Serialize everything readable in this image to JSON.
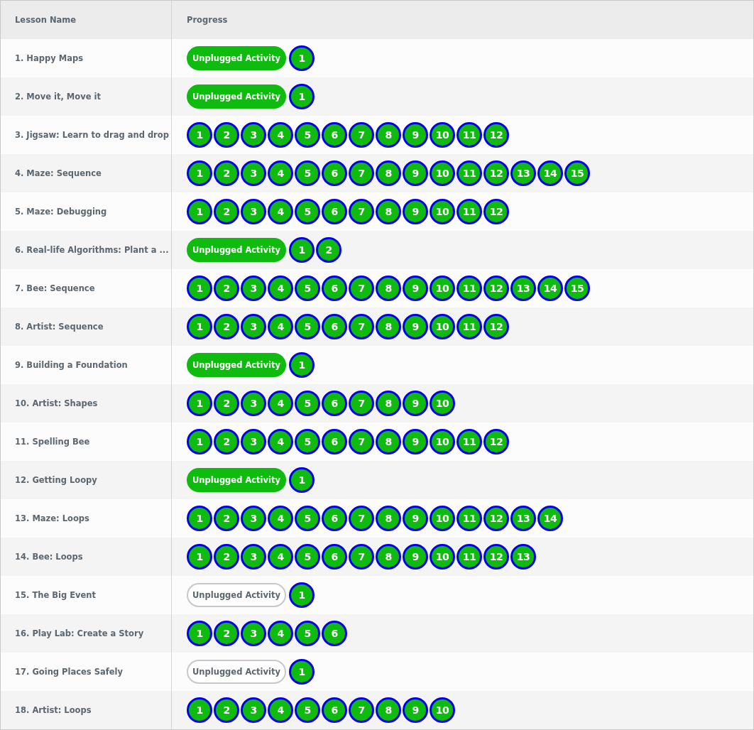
{
  "table": {
    "columns": [
      "Lesson Name",
      "Progress"
    ],
    "rows": [
      {
        "name": "1. Happy Maps",
        "unplugged": {
          "label": "Unplugged Activity",
          "completed": true
        },
        "levels": [
          "1"
        ]
      },
      {
        "name": "2. Move it, Move it",
        "unplugged": {
          "label": "Unplugged Activity",
          "completed": true
        },
        "levels": [
          "1"
        ]
      },
      {
        "name": "3. Jigsaw: Learn to drag and drop",
        "levels": [
          "1",
          "2",
          "3",
          "4",
          "5",
          "6",
          "7",
          "8",
          "9",
          "10",
          "11",
          "12"
        ]
      },
      {
        "name": "4. Maze: Sequence",
        "levels": [
          "1",
          "2",
          "3",
          "4",
          "5",
          "6",
          "7",
          "8",
          "9",
          "10",
          "11",
          "12",
          "13",
          "14",
          "15"
        ]
      },
      {
        "name": "5. Maze: Debugging",
        "levels": [
          "1",
          "2",
          "3",
          "4",
          "5",
          "6",
          "7",
          "8",
          "9",
          "10",
          "11",
          "12"
        ]
      },
      {
        "name": "6. Real-life Algorithms: Plant a ...",
        "unplugged": {
          "label": "Unplugged Activity",
          "completed": true
        },
        "levels": [
          "1",
          "2"
        ]
      },
      {
        "name": "7. Bee: Sequence",
        "levels": [
          "1",
          "2",
          "3",
          "4",
          "5",
          "6",
          "7",
          "8",
          "9",
          "10",
          "11",
          "12",
          "13",
          "14",
          "15"
        ]
      },
      {
        "name": "8. Artist: Sequence",
        "levels": [
          "1",
          "2",
          "3",
          "4",
          "5",
          "6",
          "7",
          "8",
          "9",
          "10",
          "11",
          "12"
        ]
      },
      {
        "name": "9. Building a Foundation",
        "unplugged": {
          "label": "Unplugged Activity",
          "completed": true
        },
        "levels": [
          "1"
        ]
      },
      {
        "name": "10. Artist: Shapes",
        "levels": [
          "1",
          "2",
          "3",
          "4",
          "5",
          "6",
          "7",
          "8",
          "9",
          "10"
        ]
      },
      {
        "name": "11. Spelling Bee",
        "levels": [
          "1",
          "2",
          "3",
          "4",
          "5",
          "6",
          "7",
          "8",
          "9",
          "10",
          "11",
          "12"
        ]
      },
      {
        "name": "12. Getting Loopy",
        "unplugged": {
          "label": "Unplugged Activity",
          "completed": true
        },
        "levels": [
          "1"
        ]
      },
      {
        "name": "13. Maze: Loops",
        "levels": [
          "1",
          "2",
          "3",
          "4",
          "5",
          "6",
          "7",
          "8",
          "9",
          "10",
          "11",
          "12",
          "13",
          "14"
        ]
      },
      {
        "name": "14. Bee: Loops",
        "levels": [
          "1",
          "2",
          "3",
          "4",
          "5",
          "6",
          "7",
          "8",
          "9",
          "10",
          "11",
          "12",
          "13"
        ]
      },
      {
        "name": "15. The Big Event",
        "unplugged": {
          "label": "Unplugged Activity",
          "completed": false
        },
        "levels": [
          "1"
        ]
      },
      {
        "name": "16. Play Lab: Create a Story",
        "levels": [
          "1",
          "2",
          "3",
          "4",
          "5",
          "6"
        ]
      },
      {
        "name": "17. Going Places Safely",
        "unplugged": {
          "label": "Unplugged Activity",
          "completed": false
        },
        "levels": [
          "1"
        ]
      },
      {
        "name": "18. Artist: Loops",
        "levels": [
          "1",
          "2",
          "3",
          "4",
          "5",
          "6",
          "7",
          "8",
          "9",
          "10"
        ]
      }
    ]
  }
}
